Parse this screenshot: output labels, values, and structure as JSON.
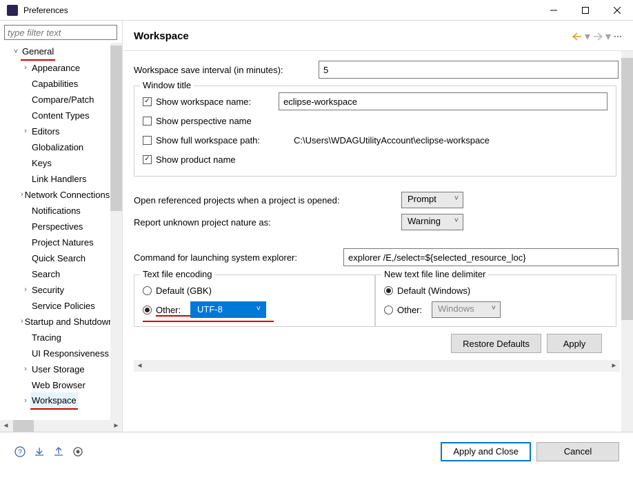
{
  "titlebar": {
    "title": "Preferences"
  },
  "sidebar": {
    "filter_placeholder": "type filter text",
    "items": [
      {
        "arrow": "v",
        "label": "General",
        "indent": 0,
        "red": true
      },
      {
        "arrow": ">",
        "label": "Appearance",
        "indent": 1
      },
      {
        "arrow": "",
        "label": "Capabilities",
        "indent": 1
      },
      {
        "arrow": "",
        "label": "Compare/Patch",
        "indent": 1
      },
      {
        "arrow": "",
        "label": "Content Types",
        "indent": 1
      },
      {
        "arrow": ">",
        "label": "Editors",
        "indent": 1
      },
      {
        "arrow": "",
        "label": "Globalization",
        "indent": 1
      },
      {
        "arrow": "",
        "label": "Keys",
        "indent": 1
      },
      {
        "arrow": "",
        "label": "Link Handlers",
        "indent": 1
      },
      {
        "arrow": ">",
        "label": "Network Connections",
        "indent": 1
      },
      {
        "arrow": "",
        "label": "Notifications",
        "indent": 1
      },
      {
        "arrow": "",
        "label": "Perspectives",
        "indent": 1
      },
      {
        "arrow": "",
        "label": "Project Natures",
        "indent": 1
      },
      {
        "arrow": "",
        "label": "Quick Search",
        "indent": 1
      },
      {
        "arrow": "",
        "label": "Search",
        "indent": 1
      },
      {
        "arrow": ">",
        "label": "Security",
        "indent": 1
      },
      {
        "arrow": "",
        "label": "Service Policies",
        "indent": 1
      },
      {
        "arrow": ">",
        "label": "Startup and Shutdown",
        "indent": 1
      },
      {
        "arrow": "",
        "label": "Tracing",
        "indent": 1
      },
      {
        "arrow": "",
        "label": "UI Responsiveness",
        "indent": 1
      },
      {
        "arrow": ">",
        "label": "User Storage",
        "indent": 1
      },
      {
        "arrow": "",
        "label": "Web Browser",
        "indent": 1
      },
      {
        "arrow": ">",
        "label": "Workspace",
        "indent": 1,
        "red": true,
        "selected": true
      }
    ]
  },
  "content": {
    "heading": "Workspace",
    "save_interval_label": "Workspace save interval (in minutes):",
    "save_interval_value": "5",
    "window_title_group": "Window title",
    "show_ws_name_label": "Show workspace name:",
    "show_ws_name_value": "eclipse-workspace",
    "show_persp_label": "Show perspective name",
    "show_full_path_label": "Show full workspace path:",
    "full_path_value": "C:\\Users\\WDAGUtilityAccount\\eclipse-workspace",
    "show_product_label": "Show product name",
    "open_ref_label": "Open referenced projects when a project is opened:",
    "open_ref_value": "Prompt",
    "report_nature_label": "Report unknown project nature as:",
    "report_nature_value": "Warning",
    "cmd_explorer_label": "Command for launching system explorer:",
    "cmd_explorer_value": "explorer /E,/select=${selected_resource_loc}",
    "encoding_title": "Text file encoding",
    "enc_default_label": "Default (GBK)",
    "enc_other_label": "Other:",
    "enc_other_value": "UTF-8",
    "delim_title": "New text file line delimiter",
    "delim_default_label": "Default (Windows)",
    "delim_other_label": "Other:",
    "delim_other_value": "Windows",
    "restore_btn": "Restore Defaults",
    "apply_btn": "Apply"
  },
  "footer": {
    "apply_close": "Apply and Close",
    "cancel": "Cancel"
  }
}
